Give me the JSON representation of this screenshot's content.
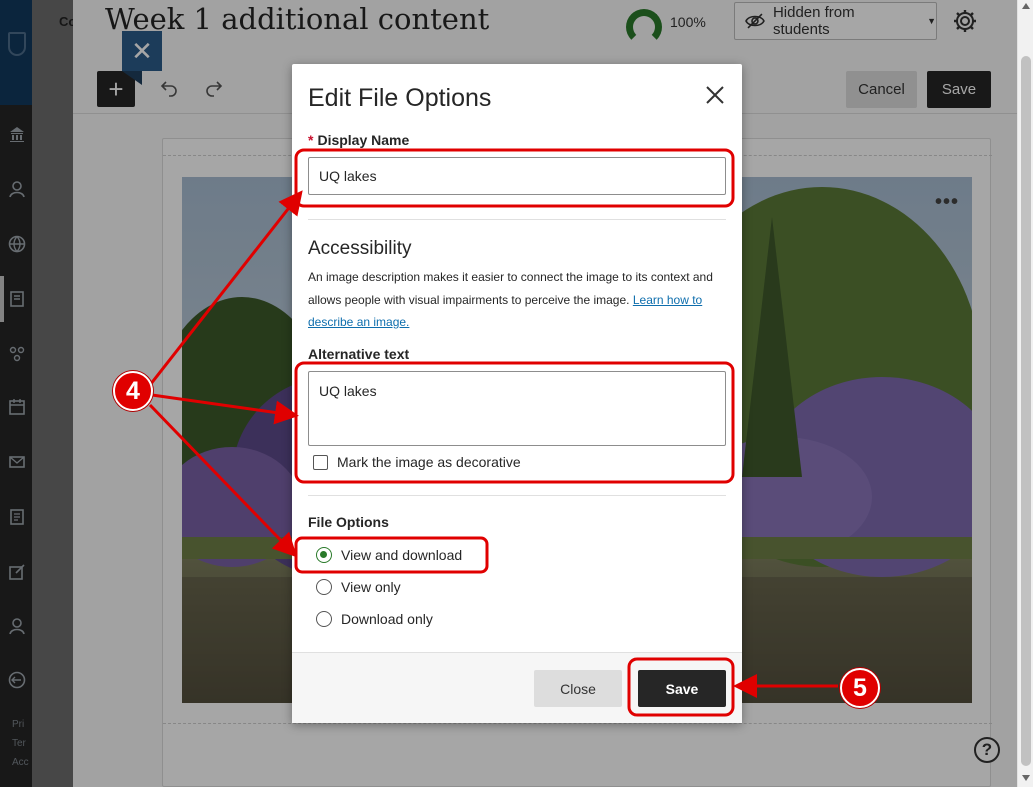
{
  "left_nav": {
    "footer_lines": [
      "Pri",
      "Ter",
      "Acc"
    ]
  },
  "header": {
    "cut_label": "Co",
    "title": "Week 1 additional content",
    "progress_percent": "100%",
    "visibility_label": "Hidden from students"
  },
  "toolbar": {
    "cancel_label": "Cancel",
    "save_label": "Save"
  },
  "modal": {
    "title": "Edit File Options",
    "display_name": {
      "required_mark": "*",
      "label": "Display Name",
      "value": "UQ lakes"
    },
    "accessibility": {
      "heading": "Accessibility",
      "description": "An image description makes it easier to connect the image to its context and allows people with visual impairments to perceive the image.",
      "link_text": "Learn how to describe an image."
    },
    "alt_text": {
      "label": "Alternative text",
      "value": "UQ lakes"
    },
    "decorative_label": "Mark the image as decorative",
    "decorative_checked": false,
    "file_options": {
      "label": "File Options",
      "options": [
        {
          "label": "View and download",
          "selected": true
        },
        {
          "label": "View only",
          "selected": false
        },
        {
          "label": "Download only",
          "selected": false
        }
      ]
    },
    "close_label": "Close",
    "save_label": "Save"
  },
  "annotations": {
    "step_4": "4",
    "step_5": "5",
    "color": "#e00000"
  },
  "colors": {
    "accent_green": "#2a7a2a",
    "dark_button": "#262626",
    "nav_bg": "#262626",
    "nav_top": "#123a5e",
    "link": "#0e6ead"
  }
}
